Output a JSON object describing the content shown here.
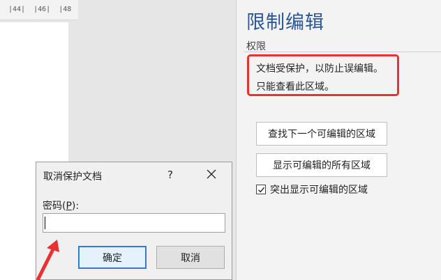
{
  "ruler": {
    "text": "|44|  |46|  |48"
  },
  "pane": {
    "title": "限制编辑",
    "section": "权限",
    "permission_line1": "文档受保护，以防止误编辑。",
    "permission_line2": "只能查看此区域。",
    "find_next_button": "查找下一个可编辑的区域",
    "show_all_button": "显示可编辑的所有区域",
    "highlight_checkbox": {
      "label": "突出显示可编辑的区域",
      "checked": true
    }
  },
  "dialog": {
    "title": "取消保护文档",
    "help": "?",
    "password_label_prefix": "密码(",
    "password_label_key": "P",
    "password_label_suffix": "):",
    "password_value": "",
    "ok_button": "确定",
    "cancel_button": "取消"
  },
  "colors": {
    "title_blue": "#2b5797",
    "highlight_red": "#e63232",
    "ok_border": "#2f7bd6"
  },
  "icons": {
    "close": "close-icon",
    "check": "checkmark-icon"
  }
}
